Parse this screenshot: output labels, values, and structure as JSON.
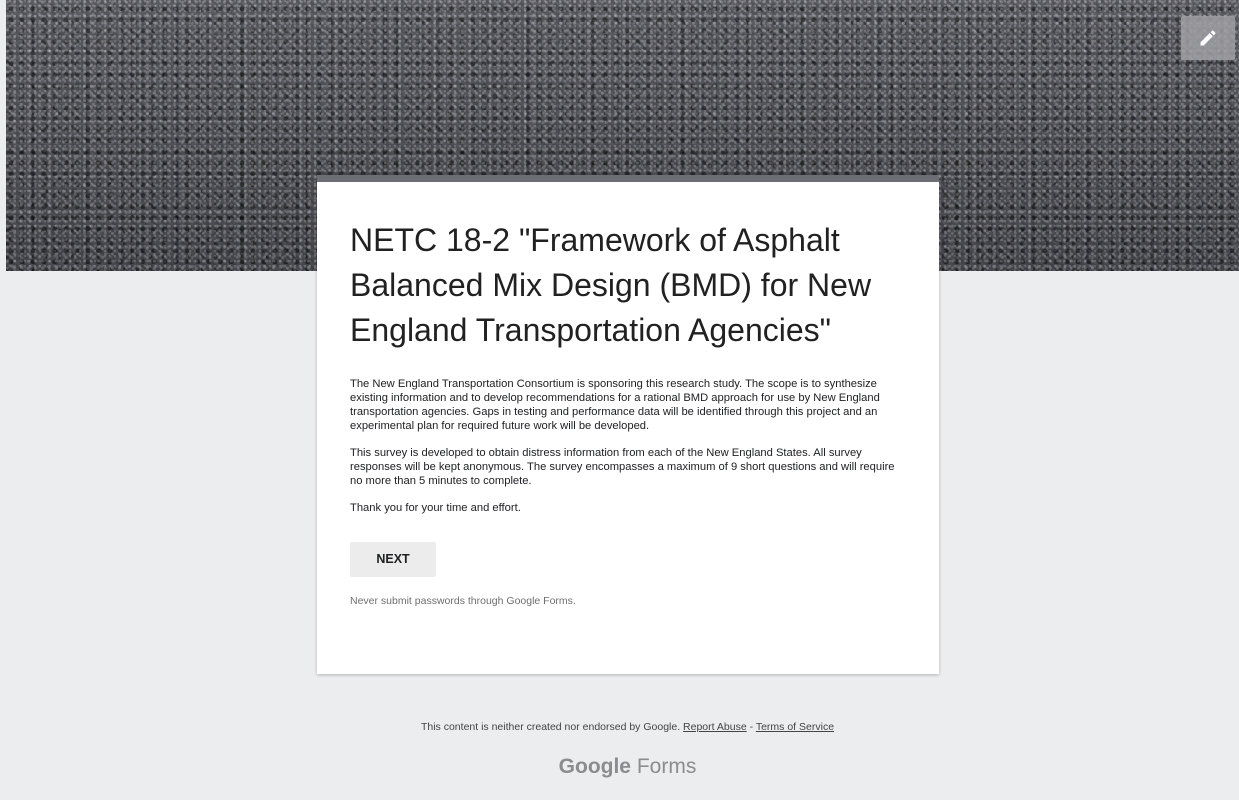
{
  "header": {
    "edit_icon": "pencil-icon"
  },
  "form": {
    "title": "NETC 18-2 \"Framework of Asphalt Balanced Mix Design (BMD) for New England Transportation Agencies\"",
    "description_paragraphs": [
      "The New England Transportation Consortium is sponsoring this research study. The scope is to synthesize existing information and to develop recommendations for a rational BMD approach for use by New England transportation agencies. Gaps in testing and performance data will be identified through this project and an experimental plan for required future work will be developed.",
      "This survey is developed to obtain distress information from each of the New England States. All survey responses will be kept anonymous. The survey encompasses a maximum of 9 short questions and will require no more than 5 minutes to complete.",
      "Thank you for your time and effort."
    ],
    "next_label": "NEXT",
    "password_warning": "Never submit passwords through Google Forms."
  },
  "footer": {
    "notice": "This content is neither created nor endorsed by Google.",
    "report_abuse": "Report Abuse",
    "separator": " - ",
    "terms": "Terms of Service",
    "brand_google": "Google",
    "brand_forms": "Forms"
  },
  "colors": {
    "background": "#ecedef",
    "card_top_bar": "#6c6e74"
  }
}
